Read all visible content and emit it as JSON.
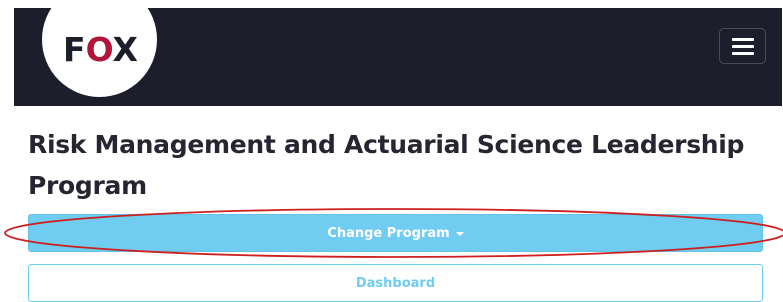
{
  "header": {
    "logo_text_pre": "F",
    "logo_text_o": "O",
    "logo_text_post": "X",
    "menu_icon": "hamburger-icon"
  },
  "main": {
    "title": "Risk Management and Actuarial Science Leadership Program",
    "change_program_label": "Change Program",
    "dashboard_label": "Dashboard"
  },
  "colors": {
    "navbar": "#1d1e2c",
    "primary": "#70ccf0",
    "logo_accent": "#b3153a",
    "annotation": "#cc1f1f"
  },
  "icons": {
    "caret": "caret-down-icon"
  }
}
